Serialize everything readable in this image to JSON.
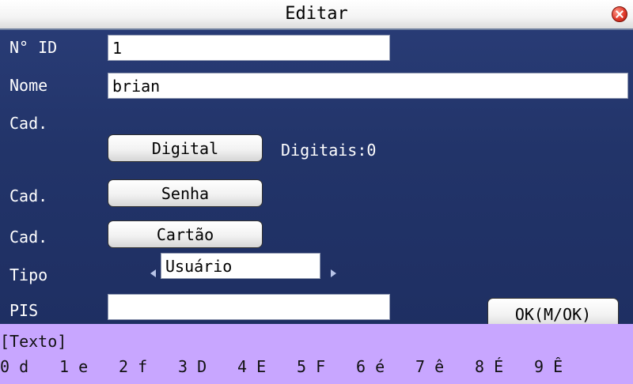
{
  "dialog": {
    "title": "Editar"
  },
  "form": {
    "id": {
      "label": "N° ID",
      "value": "1"
    },
    "name": {
      "label": "Nome",
      "value": "brian"
    },
    "enroll_fingerprint": {
      "label": "Cad.",
      "button": "Digital",
      "status": "Digitais:0"
    },
    "enroll_password": {
      "label": "Cad.",
      "button": "Senha"
    },
    "enroll_card": {
      "label": "Cad.",
      "button": "Cartão"
    },
    "type": {
      "label": "Tipo",
      "value": "Usuário"
    },
    "pis": {
      "label": "PIS",
      "value": ""
    }
  },
  "ok_button": "OK(M/OK)",
  "input_method": {
    "mode": "[Texto]",
    "keys": [
      "0 d",
      "1 e",
      "2 f",
      "3 D",
      "4 E",
      "5 F",
      "6 é",
      "7 ê",
      "8 É",
      "9 Ê"
    ]
  }
}
